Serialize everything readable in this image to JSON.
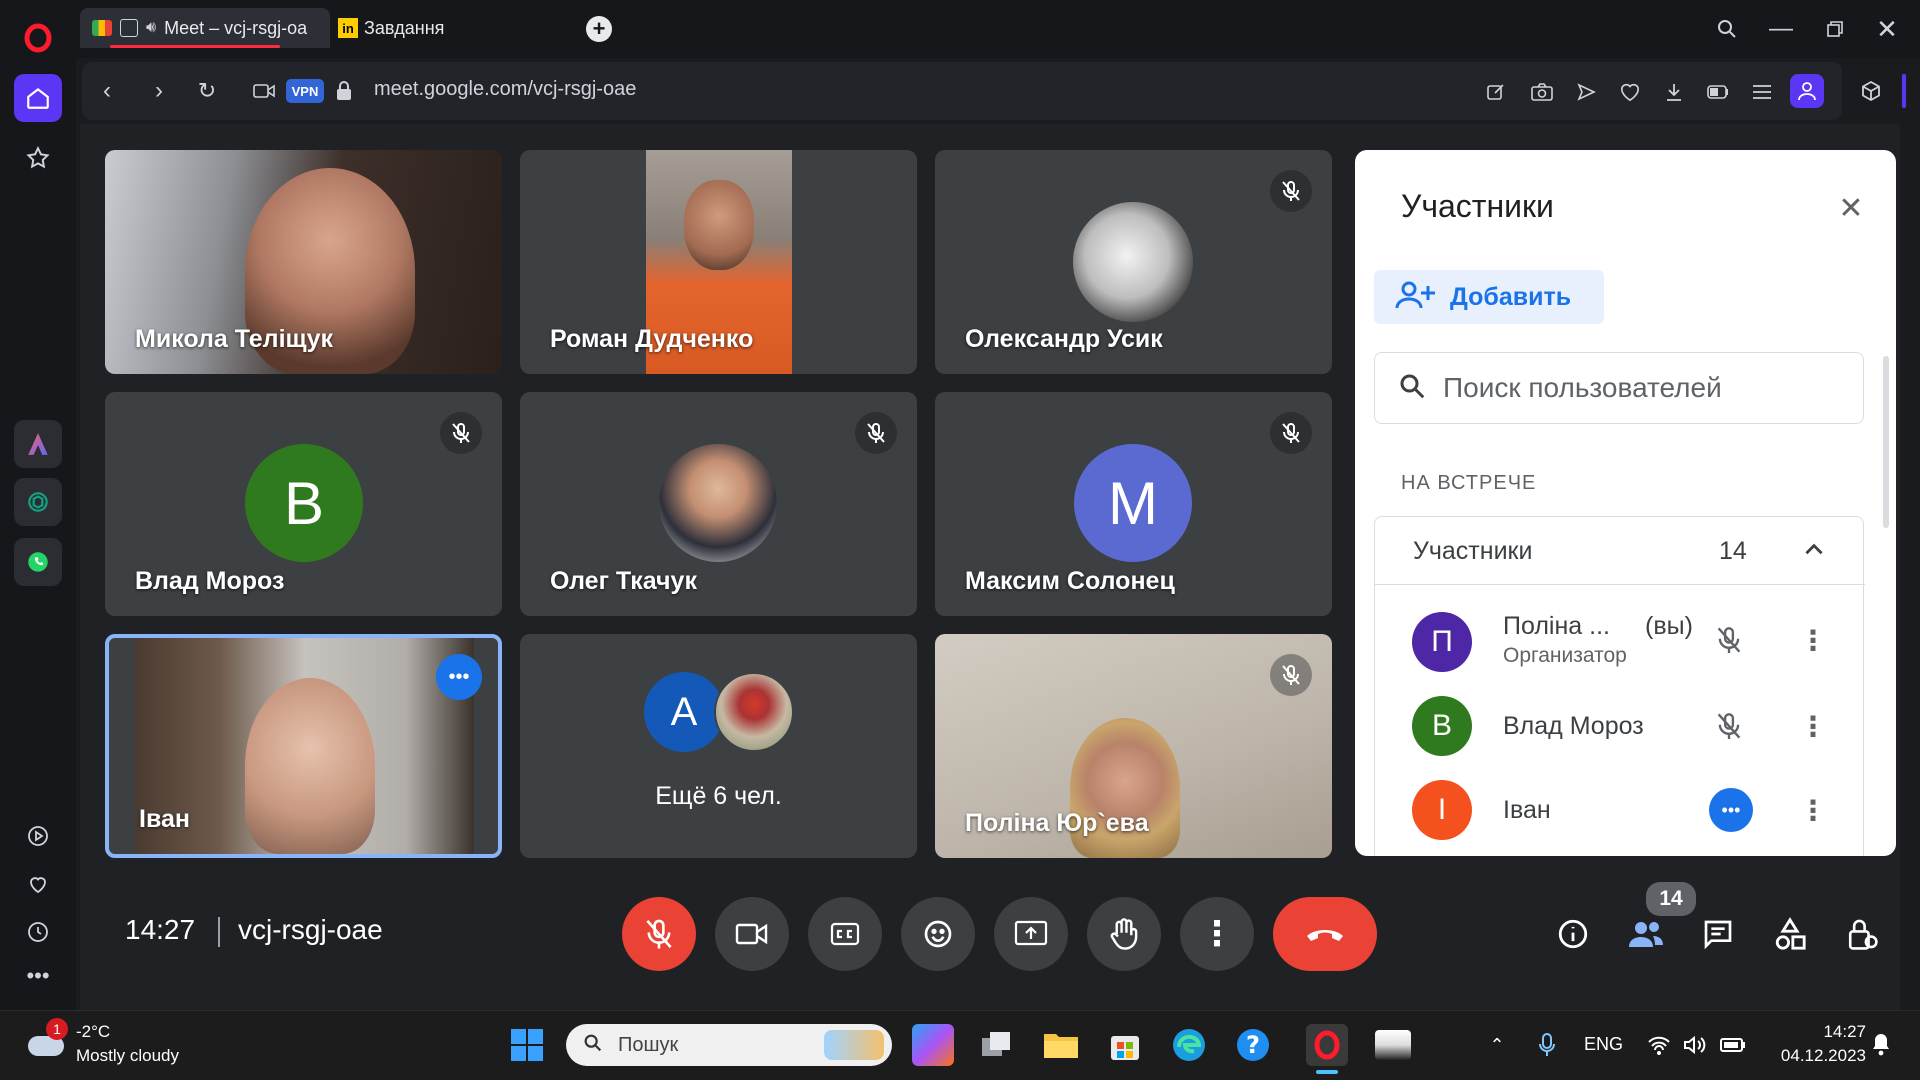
{
  "browser": {
    "tabs": [
      {
        "label": "Meet – vcj-rsgj-oa"
      },
      {
        "label": "Завдання"
      }
    ],
    "url": "meet.google.com/vcj-rsgj-oae",
    "vpn_badge": "VPN",
    "accent": "#ff2a3c"
  },
  "tiles": [
    {
      "name": "Микола Теліщук",
      "type": "video"
    },
    {
      "name": "Роман Дудченко",
      "type": "video"
    },
    {
      "name": "Олександр Усик",
      "type": "image-avatar",
      "muted": true
    },
    {
      "name": "Влад Мороз",
      "type": "letter",
      "letter": "В",
      "color": "#2f7a1f",
      "muted": true
    },
    {
      "name": "Олег Ткачук",
      "type": "image-avatar",
      "muted": true
    },
    {
      "name": "Максим Солонец",
      "type": "letter",
      "letter": "М",
      "color": "#5b6ad0",
      "muted": true
    },
    {
      "name": "Іван",
      "type": "video",
      "speaking": true
    },
    {
      "name": "Ещё 6 чел.",
      "type": "others",
      "letter": "А",
      "color": "#1459b8"
    },
    {
      "name": "Поліна Юр`ева",
      "type": "video",
      "muted": true
    }
  ],
  "panel": {
    "title": "Участники",
    "add_label": "Добавить",
    "search_placeholder": "Поиск пользователей",
    "section_label": "НА ВСТРЕЧЕ",
    "group_label": "Участники",
    "group_count": "14",
    "rows": [
      {
        "letter": "П",
        "color": "#4e27a6",
        "name": "Поліна ...",
        "you": "(вы)",
        "role": "Организатор",
        "status": "muted"
      },
      {
        "letter": "В",
        "color": "#2f7a1f",
        "name": "Влад Мороз",
        "status": "muted"
      },
      {
        "letter": "І",
        "color": "#f4511e",
        "name": "Іван",
        "status": "speaking"
      }
    ]
  },
  "controls": {
    "time": "14:27",
    "meeting_code": "vcj-rsgj-oae",
    "participants_badge": "14"
  },
  "taskbar": {
    "weather_badge": "1",
    "temperature": "-2°C",
    "weather": "Mostly cloudy",
    "search_placeholder": "Пошук",
    "language": "ENG",
    "time": "14:27",
    "date": "04.12.2023"
  }
}
